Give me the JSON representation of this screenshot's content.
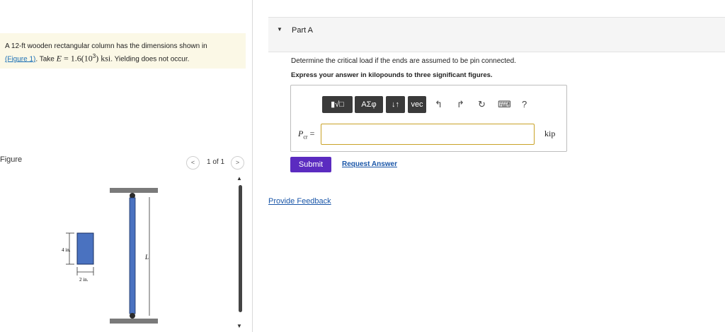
{
  "problem": {
    "line1": "A 12-ft wooden rectangular column has the dimensions shown in",
    "link_text": "(Figure 1)",
    "line2_mid": ". Take ",
    "e_symbol": "E",
    "e_value": " = 1.6(10",
    "e_exp": "3",
    "e_unit": ") ksi",
    "line2_end": ". Yielding does not occur."
  },
  "figure": {
    "label": "Figure",
    "page_indicator": "1 of 1",
    "prev_icon": "<",
    "next_icon": ">",
    "dim_height": "4 in.",
    "dim_width": "2 in.",
    "length_label": "L"
  },
  "part": {
    "title": "Part A",
    "question": "Determine the critical load if the ends are assumed to be pin connected.",
    "instruction": "Express your answer in kilopounds to three significant figures."
  },
  "toolbar": {
    "templates_label": "▮√□",
    "greek_label": "ΑΣφ",
    "arrows_label": "↓↑",
    "vec_label": "vec",
    "undo_icon": "↰",
    "redo_icon": "↱",
    "reset_icon": "↻",
    "keyboard_icon": "⌨",
    "help_icon": "?"
  },
  "answer": {
    "var_symbol": "P",
    "var_sub": "cr",
    "equals": " =",
    "value": "",
    "unit": "kip"
  },
  "actions": {
    "submit_label": "Submit",
    "request_label": "Request Answer",
    "feedback_label": "Provide Feedback"
  },
  "colors": {
    "submit": "#5b2bc0",
    "link": "#1a56a8",
    "column": "#4a72c0",
    "problem_bg": "#fbf8e6"
  }
}
